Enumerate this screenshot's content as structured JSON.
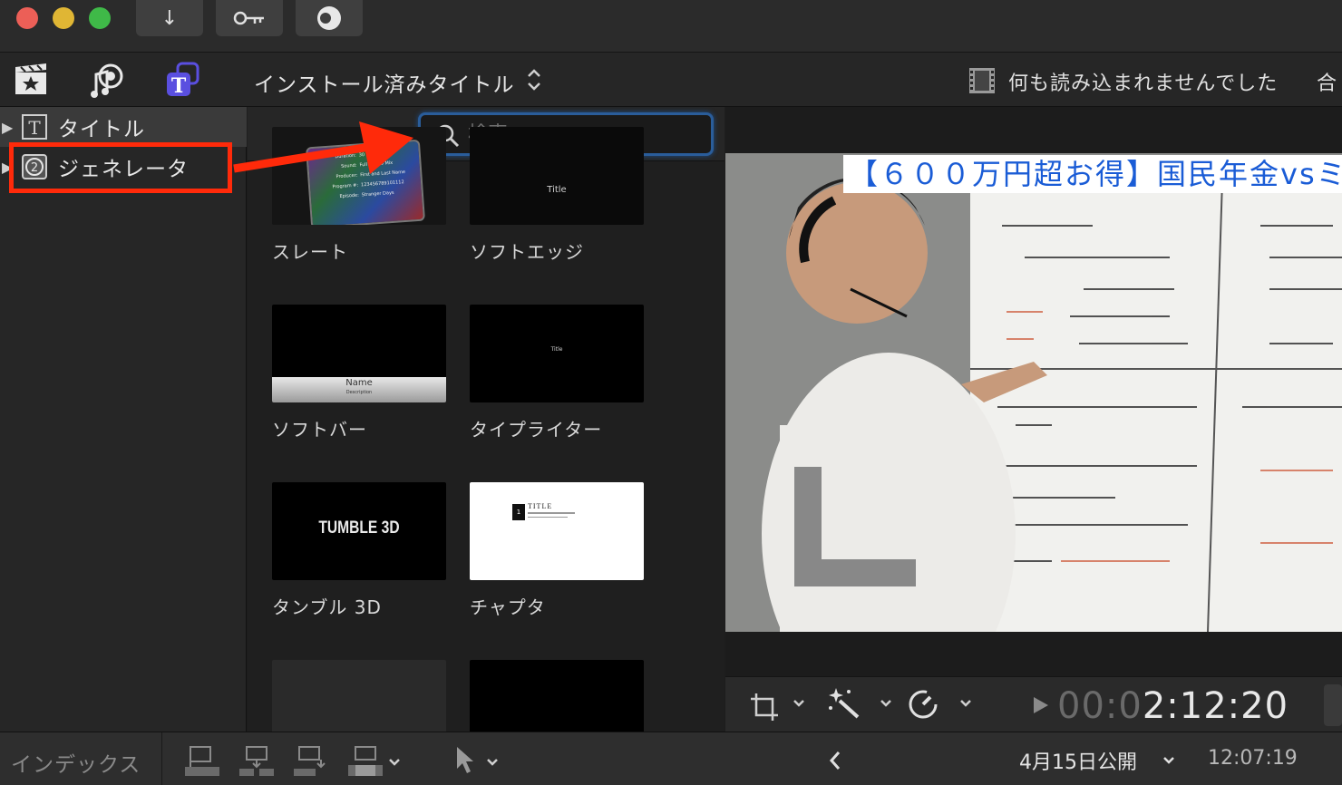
{
  "colors": {
    "accent_blue": "#2a5d9a",
    "annotation_red": "#ff2a0a",
    "title_icon_purple": "#5a4fe0"
  },
  "titlebar": {
    "traffic_lights": [
      {
        "name": "close",
        "color": "#ec5f57"
      },
      {
        "name": "minimize",
        "color": "#e0b634"
      },
      {
        "name": "zoom",
        "color": "#3fb948"
      }
    ],
    "buttons": [
      {
        "name": "import-icon",
        "glyph": "↓"
      },
      {
        "name": "key-icon",
        "glyph": "⊶"
      },
      {
        "name": "background-tasks-icon",
        "glyph": "◑"
      }
    ]
  },
  "browser": {
    "library_title": "インストール済みタイトル",
    "library_chevron": "⌃\n⌄",
    "icons": [
      "media-library-icon",
      "music-sound-icon",
      "titles-generators-icon"
    ]
  },
  "sidebar": {
    "items": [
      {
        "label": "タイトル",
        "icon": "title-T-icon"
      },
      {
        "label": "ジェネレータ",
        "icon": "generator-icon"
      }
    ]
  },
  "search": {
    "placeholder": "検索",
    "value": ""
  },
  "tiles": [
    {
      "label": "スレート",
      "thumb_text": "",
      "kind": "slate"
    },
    {
      "label": "ソフトエッジ",
      "thumb_text": "Title",
      "kind": "dark-title"
    },
    {
      "label": "ソフトバー",
      "thumb_text": "Name",
      "thumb_sub": "Description",
      "kind": "softbar"
    },
    {
      "label": "タイプライター",
      "thumb_text": "Title",
      "kind": "dark-title-small"
    },
    {
      "label": "タンブル 3D",
      "thumb_text": "TUMBLE 3D",
      "kind": "tumble"
    },
    {
      "label": "チャプタ",
      "thumb_text": "TITLE",
      "kind": "chapter"
    },
    {
      "label": "",
      "thumb_text": "",
      "kind": "grey"
    },
    {
      "label": "",
      "thumb_text": "",
      "kind": "black"
    }
  ],
  "slate_fields": [
    {
      "k": "Duration:",
      "v": "30"
    },
    {
      "k": "Sound:",
      "v": "Full Stereo Mix"
    },
    {
      "k": "Producer:",
      "v": "First and Last Name"
    },
    {
      "k": "Program #:",
      "v": "123456789101112"
    },
    {
      "k": "Episode:",
      "v": "Stranger Days"
    }
  ],
  "viewer": {
    "message": "何も読み込まれませんでした",
    "extra": "合",
    "frame_title": "【６００万円超お得】国民年金vsミ",
    "timecode_dim": "00:0",
    "timecode_bright": "2:12:20"
  },
  "bottombar": {
    "index_label": "インデックス",
    "date_label": "4月15日公開",
    "time_label": "12:07:19"
  }
}
